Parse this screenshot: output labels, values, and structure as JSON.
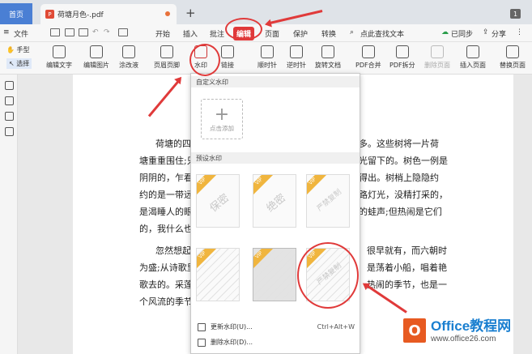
{
  "tabs": {
    "home": "首页",
    "doc": "荷塘月色-.pdf",
    "count": "1"
  },
  "menu": {
    "file": "文件",
    "items": [
      "开始",
      "插入",
      "批注",
      "编辑",
      "页面",
      "保护",
      "转换"
    ],
    "search": "点此查找文本",
    "sync": "已同步",
    "share": "分享"
  },
  "ribbon": {
    "hand": "手型",
    "select": "选择",
    "buttons": [
      "编辑文字",
      "编辑图片",
      "涂改液",
      "页眉页脚",
      "水印",
      "链接",
      "顺时针",
      "逆时针",
      "旋转文档",
      "PDF合并",
      "PDF拆分",
      "删除页面",
      "插入页面",
      "替换页面"
    ]
  },
  "doc_lines": [
    "荷塘的四",
    "塘重重围住;只",
    "阴阴的，乍看",
    "约的是一带远",
    "是渴睡人的眼",
    "的，我什么也",
    "忽然想起",
    "为盛;从诗歌里",
    "歌去的。采莲",
    "个风流的季节"
  ],
  "doc_lines_right": [
    "多。这些树将一片荷",
    "光留下的。树色一例是",
    "得出。树梢上隐隐约",
    "路灯光，没精打采的，",
    "的蛙声;但热闹是它们",
    "很早就有，而六朝时",
    "是荡着小船，唱着艳",
    "热闹的季节，也是一"
  ],
  "dropdown": {
    "custom_title": "自定义水印",
    "add_label": "点击添加",
    "preset_title": "预设水印",
    "presets": [
      "保密",
      "绝密",
      "严禁复制"
    ],
    "update": "更新水印(U)...",
    "update_shortcut": "Ctrl+Alt+W",
    "delete": "删除水印(D)...",
    "vip": "VIP"
  },
  "brand": {
    "name": "Office教程网",
    "url": "www.office26.com"
  }
}
